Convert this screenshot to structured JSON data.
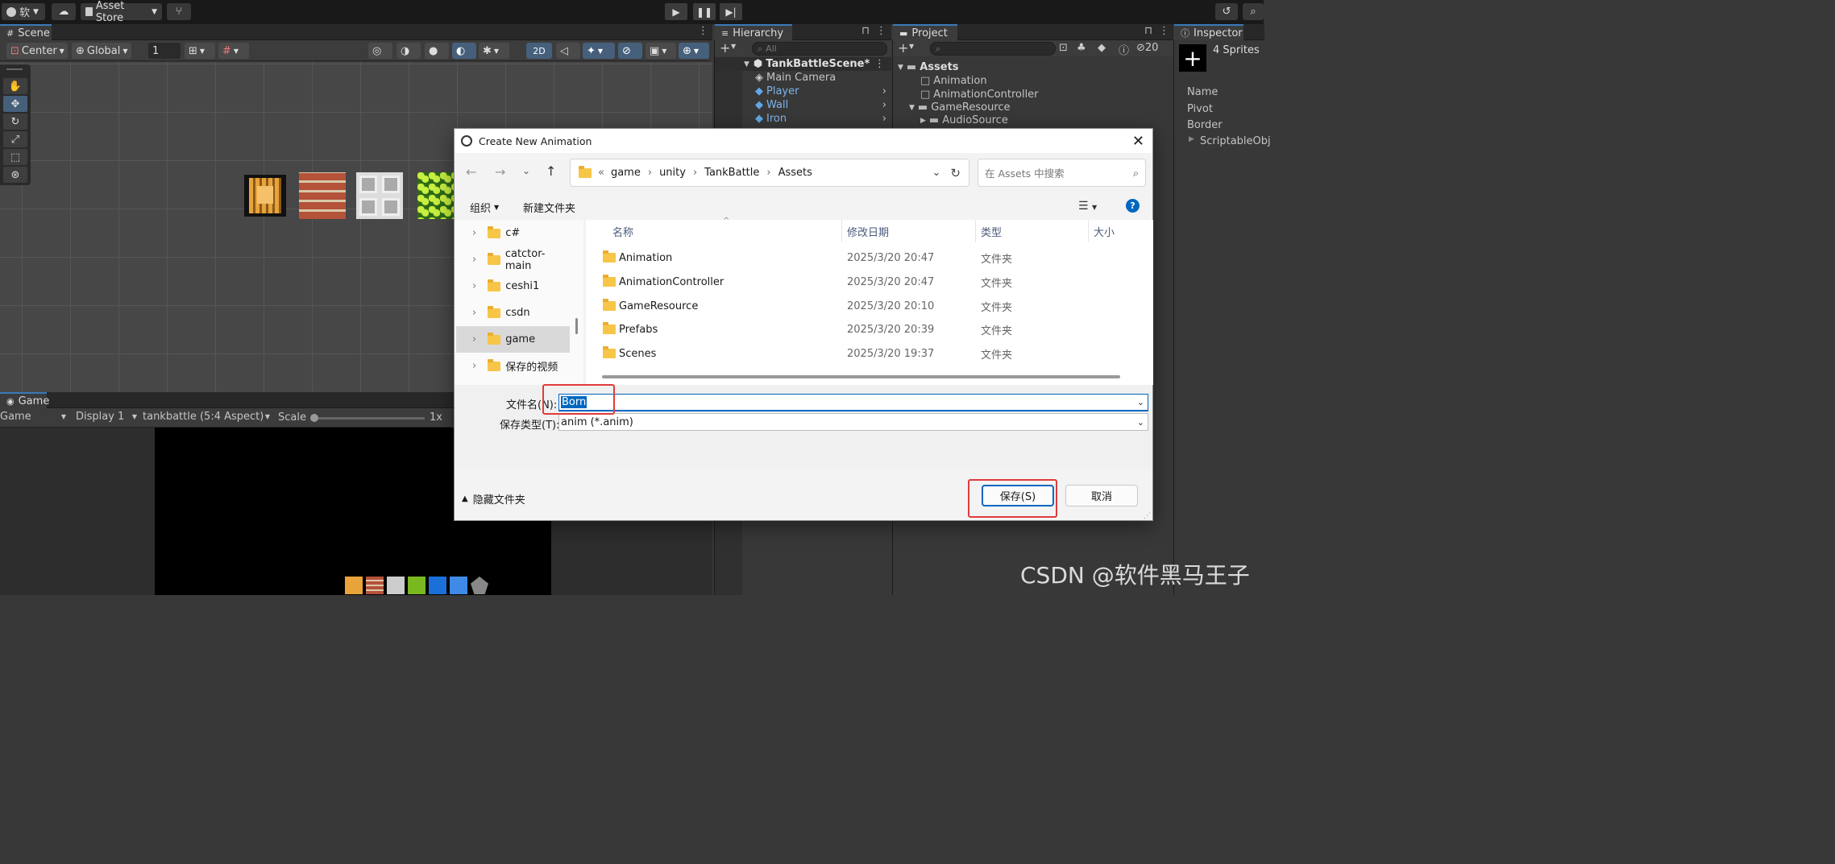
{
  "topbar": {
    "account_label": "软",
    "asset_store_label": "Asset Store"
  },
  "scene": {
    "tab_label": "Scene",
    "pivot_label": "Center",
    "space_label": "Global",
    "grid_value": "1",
    "mode_2d_label": "2D"
  },
  "game": {
    "tab_label": "Game",
    "view_select": "Game",
    "display_select": "Display 1",
    "aspect_select": "tankbattle (5:4 Aspect)",
    "scale_label": "Scale",
    "scale_value": "1x"
  },
  "hierarchy": {
    "tab_label": "Hierarchy",
    "search_placeholder": "All",
    "scene_name": "TankBattleScene*",
    "items": [
      {
        "label": "Main Camera"
      },
      {
        "label": "Player"
      },
      {
        "label": "Wall"
      },
      {
        "label": "Iron"
      }
    ]
  },
  "project": {
    "tab_label": "Project",
    "hidden_count": "20",
    "tree": [
      {
        "label": "Assets"
      },
      {
        "label": "Animation"
      },
      {
        "label": "AnimationController"
      },
      {
        "label": "GameResource"
      },
      {
        "label": "AudioSource"
      }
    ]
  },
  "inspector": {
    "tab_label": "Inspector",
    "header": "4 Sprites",
    "fields": [
      "Name",
      "Pivot",
      "Border",
      "ScriptableObj"
    ]
  },
  "dialog": {
    "title": "Create New Animation",
    "breadcrumb": [
      "game",
      "unity",
      "TankBattle",
      "Assets"
    ],
    "breadcrumb_prefix": "«",
    "search_placeholder": "在 Assets 中搜索",
    "organize_label": "组织",
    "new_folder_label": "新建文件夹",
    "help_label": "?",
    "nav_items": [
      {
        "label": "c#"
      },
      {
        "label": "catctor-main"
      },
      {
        "label": "ceshi1"
      },
      {
        "label": "csdn"
      },
      {
        "label": "game"
      },
      {
        "label": "保存的视频"
      }
    ],
    "columns": {
      "name": "名称",
      "modified": "修改日期",
      "type": "类型",
      "size": "大小"
    },
    "files": [
      {
        "name": "Animation",
        "modified": "2025/3/20 20:47",
        "type": "文件夹"
      },
      {
        "name": "AnimationController",
        "modified": "2025/3/20 20:47",
        "type": "文件夹"
      },
      {
        "name": "GameResource",
        "modified": "2025/3/20 20:10",
        "type": "文件夹"
      },
      {
        "name": "Prefabs",
        "modified": "2025/3/20 20:39",
        "type": "文件夹"
      },
      {
        "name": "Scenes",
        "modified": "2025/3/20 19:37",
        "type": "文件夹"
      }
    ],
    "filename_label": "文件名(N):",
    "filename_value": "Born",
    "filetype_label": "保存类型(T):",
    "filetype_value": "anim (*.anim)",
    "hide_folders_label": "隐藏文件夹",
    "save_label": "保存(S)",
    "cancel_label": "取消"
  },
  "watermark": "CSDN @软件黑马王子",
  "colors": {
    "unity_dark": "#383838",
    "selection_blue": "#46607c",
    "highlight_red": "#e03b3b",
    "win_accent": "#0067c0"
  }
}
